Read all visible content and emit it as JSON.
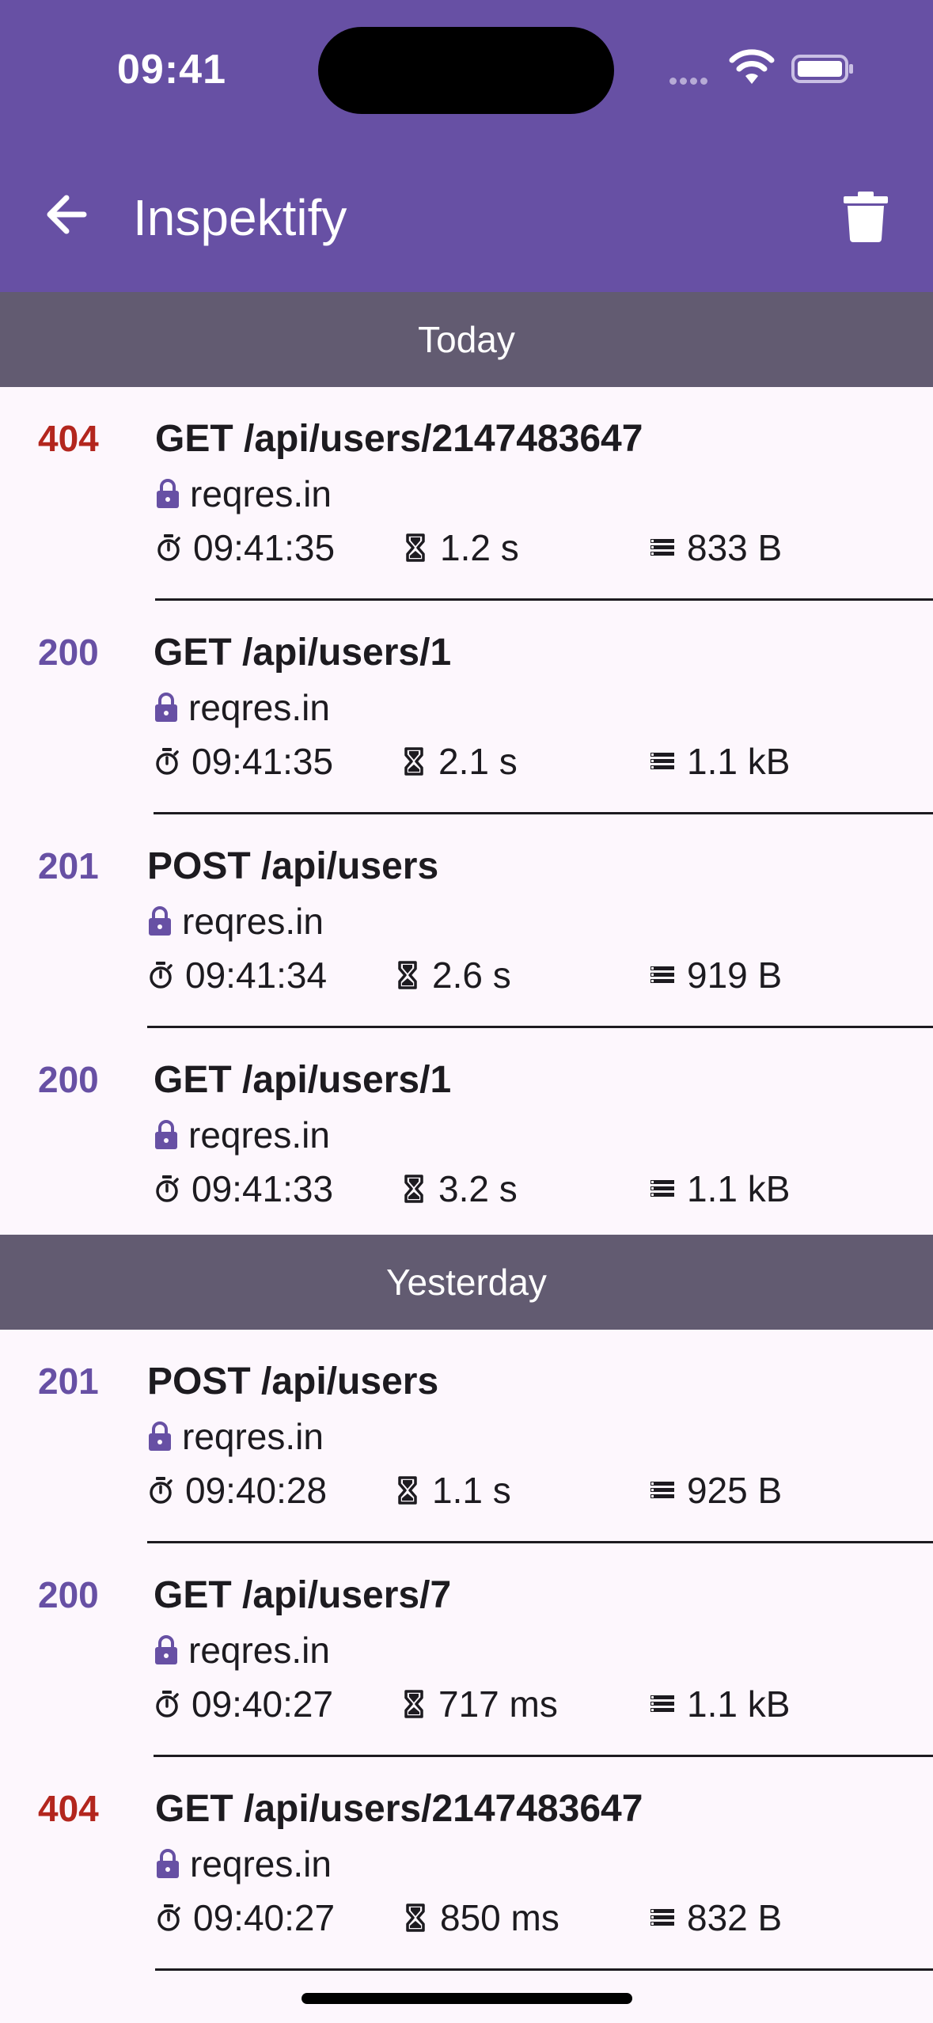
{
  "status_bar": {
    "time": "09:41"
  },
  "app_bar": {
    "title": "Inspektify"
  },
  "sections": [
    {
      "title": "Today",
      "items": [
        {
          "status": "404",
          "request": "GET /api/users/2147483647",
          "host": "reqres.in",
          "time": "09:41:35",
          "duration": "1.2 s",
          "size": "833 B"
        },
        {
          "status": "200",
          "request": "GET /api/users/1",
          "host": "reqres.in",
          "time": "09:41:35",
          "duration": "2.1 s",
          "size": "1.1 kB"
        },
        {
          "status": "201",
          "request": "POST /api/users",
          "host": "reqres.in",
          "time": "09:41:34",
          "duration": "2.6 s",
          "size": "919 B"
        },
        {
          "status": "200",
          "request": "GET /api/users/1",
          "host": "reqres.in",
          "time": "09:41:33",
          "duration": "3.2 s",
          "size": "1.1 kB"
        }
      ]
    },
    {
      "title": "Yesterday",
      "items": [
        {
          "status": "201",
          "request": "POST /api/users",
          "host": "reqres.in",
          "time": "09:40:28",
          "duration": "1.1 s",
          "size": "925 B"
        },
        {
          "status": "200",
          "request": "GET /api/users/7",
          "host": "reqres.in",
          "time": "09:40:27",
          "duration": "717 ms",
          "size": "1.1 kB"
        },
        {
          "status": "404",
          "request": "GET /api/users/2147483647",
          "host": "reqres.in",
          "time": "09:40:27",
          "duration": "850 ms",
          "size": "832 B"
        }
      ]
    }
  ],
  "colors": {
    "primary": "#6750a4",
    "error": "#b3261e",
    "section_header": "#625b71",
    "background": "#fdf7fd"
  },
  "icons": {
    "back": "arrow-left-icon",
    "delete": "trash-icon",
    "secure": "lock-icon",
    "time": "stopwatch-icon",
    "duration": "hourglass-icon",
    "size": "storage-icon"
  }
}
